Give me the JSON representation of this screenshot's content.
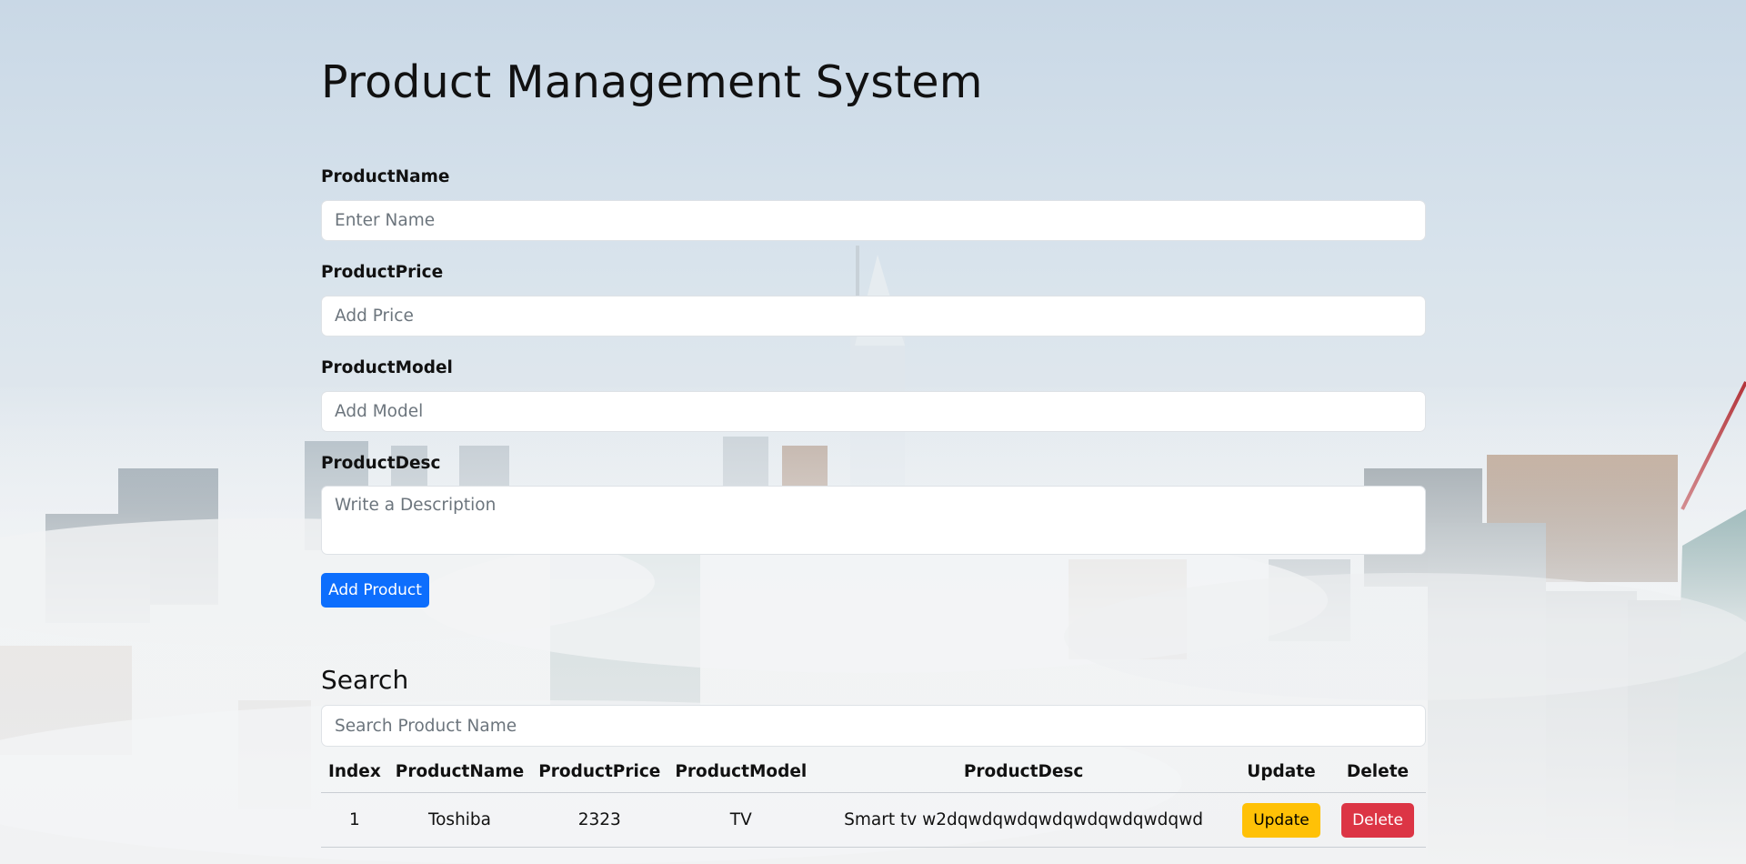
{
  "app": {
    "title": "Product Management System"
  },
  "form": {
    "name_label": "ProductName",
    "name_placeholder": "Enter Name",
    "name_value": "",
    "price_label": "ProductPrice",
    "price_placeholder": "Add Price",
    "price_value": "",
    "model_label": "ProductModel",
    "model_placeholder": "Add Model",
    "model_value": "",
    "desc_label": "ProductDesc",
    "desc_placeholder": "Write a Description",
    "desc_value": "",
    "submit_label": "Add Product"
  },
  "search": {
    "title": "Search",
    "placeholder": "Search Product Name",
    "value": ""
  },
  "table": {
    "headers": [
      "Index",
      "ProductName",
      "ProductPrice",
      "ProductModel",
      "ProductDesc",
      "Update",
      "Delete"
    ],
    "rows": [
      {
        "index": "1",
        "name": "Toshiba",
        "price": "2323",
        "model": "TV",
        "desc": "Smart tv w2dqwdqwdqwdqwdqwdqwdqwd",
        "update_label": "Update",
        "delete_label": "Delete"
      }
    ]
  },
  "colors": {
    "primary": "#0d6efd",
    "warning": "#ffc107",
    "danger": "#dc3545"
  },
  "background": {
    "description_icon": "city-skyline-in-fog"
  }
}
